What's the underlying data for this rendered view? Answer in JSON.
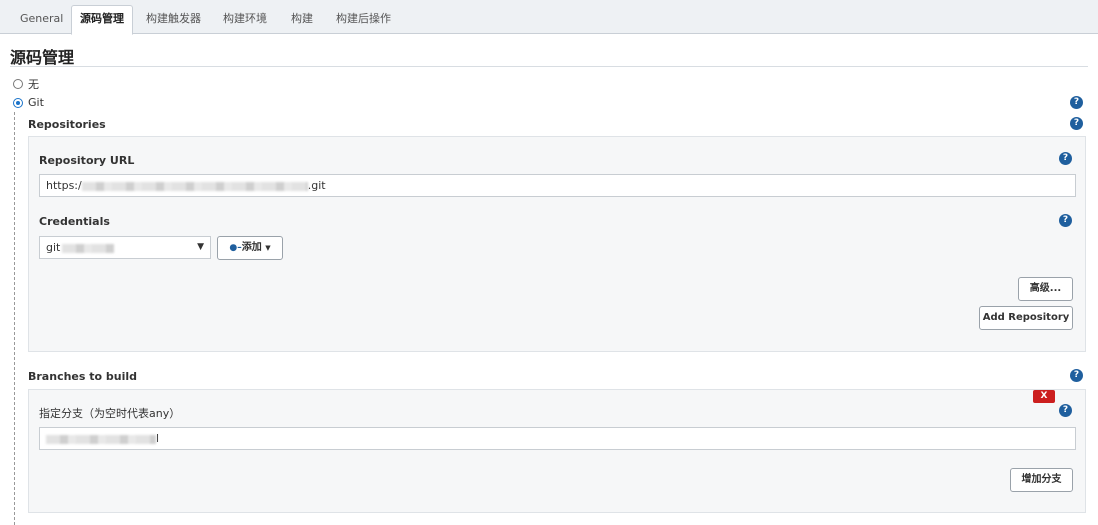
{
  "tabs": [
    {
      "label": "General"
    },
    {
      "label": "源码管理"
    },
    {
      "label": "构建触发器"
    },
    {
      "label": "构建环境"
    },
    {
      "label": "构建"
    },
    {
      "label": "构建后操作"
    }
  ],
  "section": {
    "title": "源码管理"
  },
  "scm_options": {
    "none_label": "无",
    "git_label": "Git",
    "selected": "Git"
  },
  "repositories": {
    "label": "Repositories",
    "url_label": "Repository URL",
    "url_prefix": "https:/",
    "url_suffix": ".git",
    "credentials_label": "Credentials",
    "credentials_value": "git",
    "add_button_label": "添加",
    "advanced_button_label": "高级...",
    "add_repository_button_label": "Add Repository"
  },
  "branches": {
    "label": "Branches to build",
    "delete_label": "X",
    "specifier_label": "指定分支（为空时代表any）",
    "specifier_value_tail": "l",
    "add_branch_button_label": "增加分支"
  },
  "icons": {
    "help": "help-icon",
    "key": "key-icon",
    "dropdown": "chevron-down-icon"
  },
  "colors": {
    "help_icon": "#1f5f9e",
    "delete_button": "#cc1f1f",
    "radio_checked": "#1a73c9"
  }
}
